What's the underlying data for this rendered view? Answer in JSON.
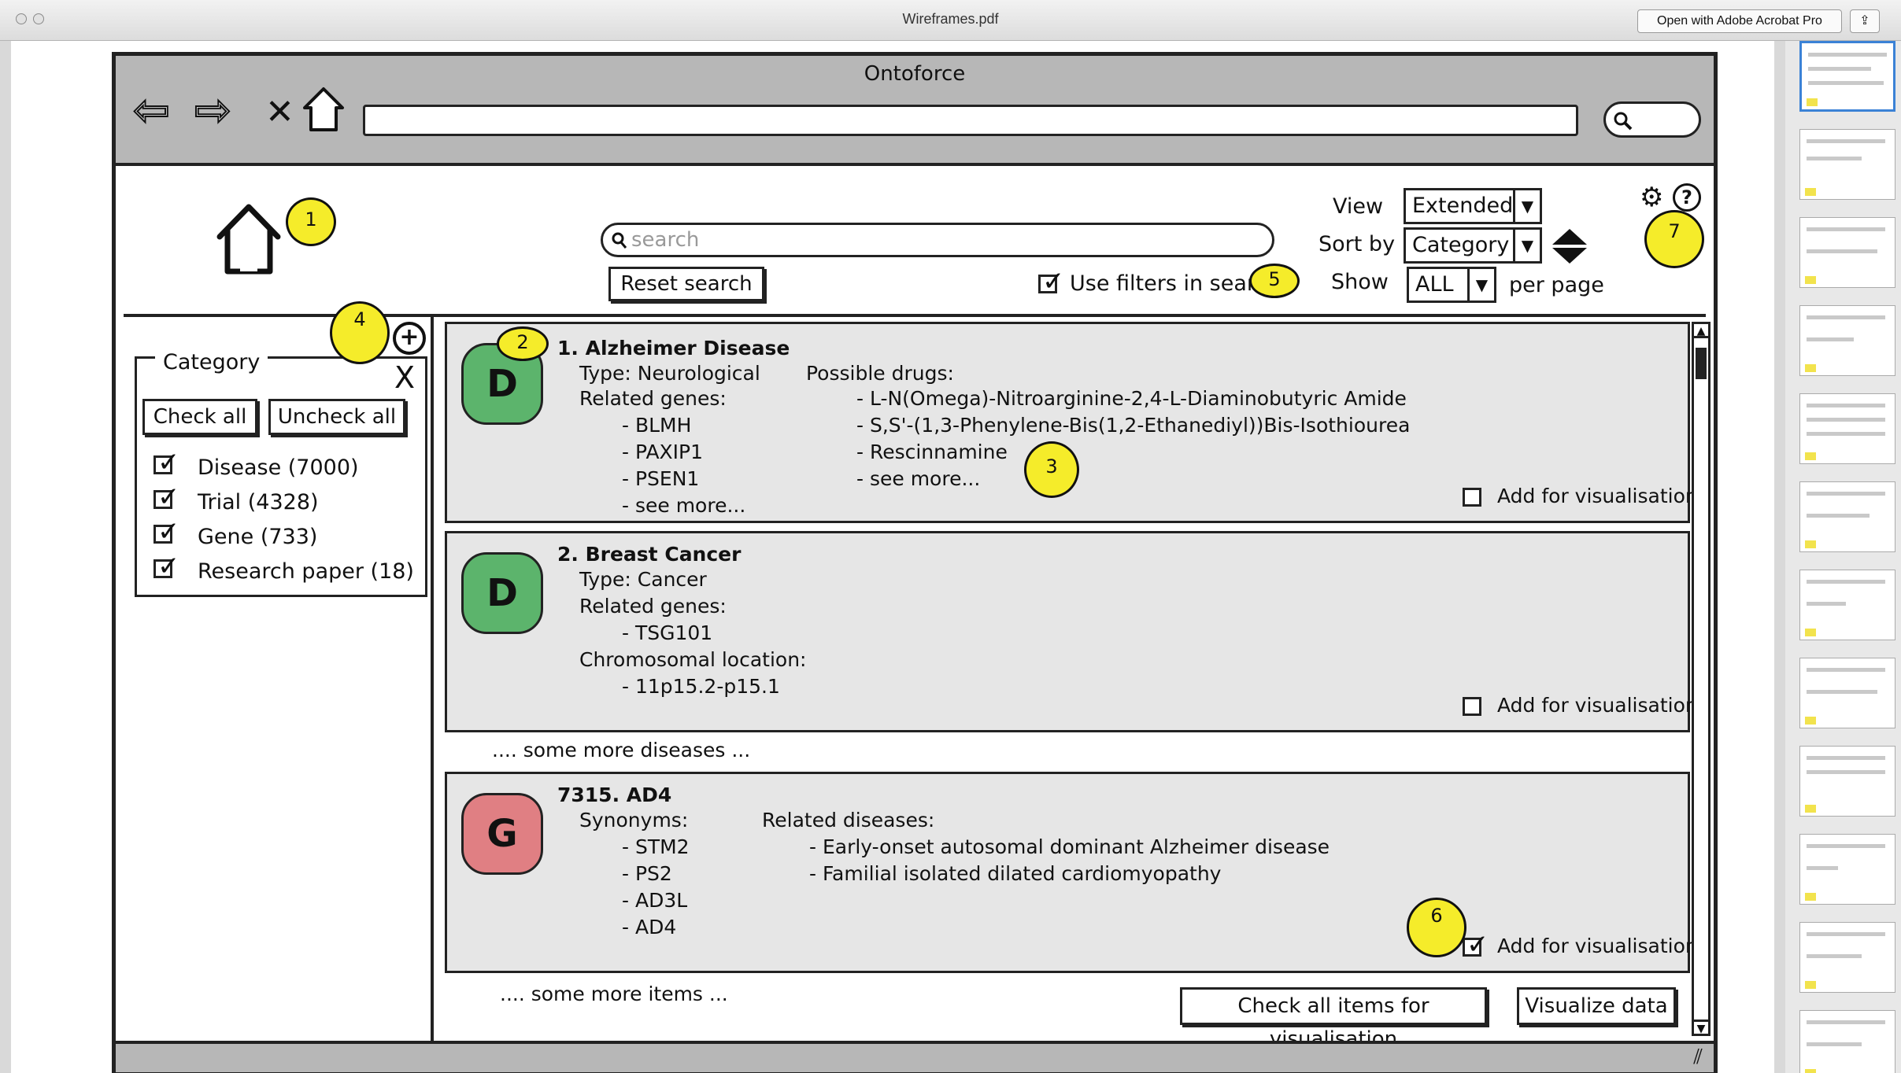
{
  "viewer": {
    "title": "Wireframes.pdf",
    "open_with_label": "Open with Adobe Acrobat Pro"
  },
  "browser": {
    "title": "Ontoforce"
  },
  "toolbar": {
    "search_placeholder": "search",
    "reset_label": "Reset search",
    "use_filters_label": "Use filters in search",
    "use_filters_checked": true,
    "view_label": "View",
    "view_value": "Extended",
    "sort_label": "Sort by",
    "sort_value": "Category",
    "show_label": "Show",
    "show_value": "ALL",
    "per_page_label": "per page"
  },
  "sidebar": {
    "legend": "Category",
    "close_label": "X",
    "check_all_label": "Check all",
    "uncheck_all_label": "Uncheck all",
    "items": [
      {
        "label": "Disease (7000)",
        "checked": true
      },
      {
        "label": "Trial (4328)",
        "checked": true
      },
      {
        "label": "Gene (733)",
        "checked": true
      },
      {
        "label": "Research paper (18)",
        "checked": true
      }
    ]
  },
  "results": [
    {
      "badge": "D",
      "title": "1. Alzheimer Disease",
      "type": "Type: Neurological",
      "related_genes_label": "Related genes:",
      "genes": [
        "- BLMH",
        "- PAXIP1",
        "- PSEN1",
        "- see more..."
      ],
      "drugs_label": "Possible drugs:",
      "drugs": [
        "- L-N(Omega)-Nitroarginine-2,4-L-Diaminobutyric Amide",
        "- S,S'-(1,3-Phenylene-Bis(1,2-Ethanediyl))Bis-Isothiourea",
        "- Rescinnamine",
        "- see more..."
      ],
      "visualise_label": "Add for visualisation",
      "visualise_checked": false
    },
    {
      "badge": "D",
      "title": "2. Breast Cancer",
      "type": "Type: Cancer",
      "related_genes_label": "Related genes:",
      "genes": [
        "- TSG101"
      ],
      "chromosome_label": "Chromosomal location:",
      "chromosome": "- 11p15.2-p15.1",
      "visualise_label": "Add for visualisation",
      "visualise_checked": false
    },
    {
      "badge": "G",
      "title": "7315. AD4",
      "synonyms_label": "Synonyms:",
      "synonyms": [
        "- STM2",
        "- PS2",
        "- AD3L",
        "- AD4"
      ],
      "diseases_label": "Related diseases:",
      "diseases": [
        "- Early-onset autosomal dominant Alzheimer disease",
        "- Familial isolated dilated cardiomyopathy"
      ],
      "visualise_label": "Add for visualisation",
      "visualise_checked": true
    }
  ],
  "separators": {
    "more_diseases": ".... some more diseases ...",
    "more_items": ".... some more items ..."
  },
  "footer": {
    "check_all_vis_label": "Check all items for visualisation",
    "visualize_label": "Visualize data"
  },
  "markers": [
    "1",
    "2",
    "3",
    "4",
    "5",
    "6",
    "7"
  ],
  "colors": {
    "disease_badge": "#5cb46c",
    "gene_badge": "#e07f83",
    "marker": "#f5ec2a"
  }
}
